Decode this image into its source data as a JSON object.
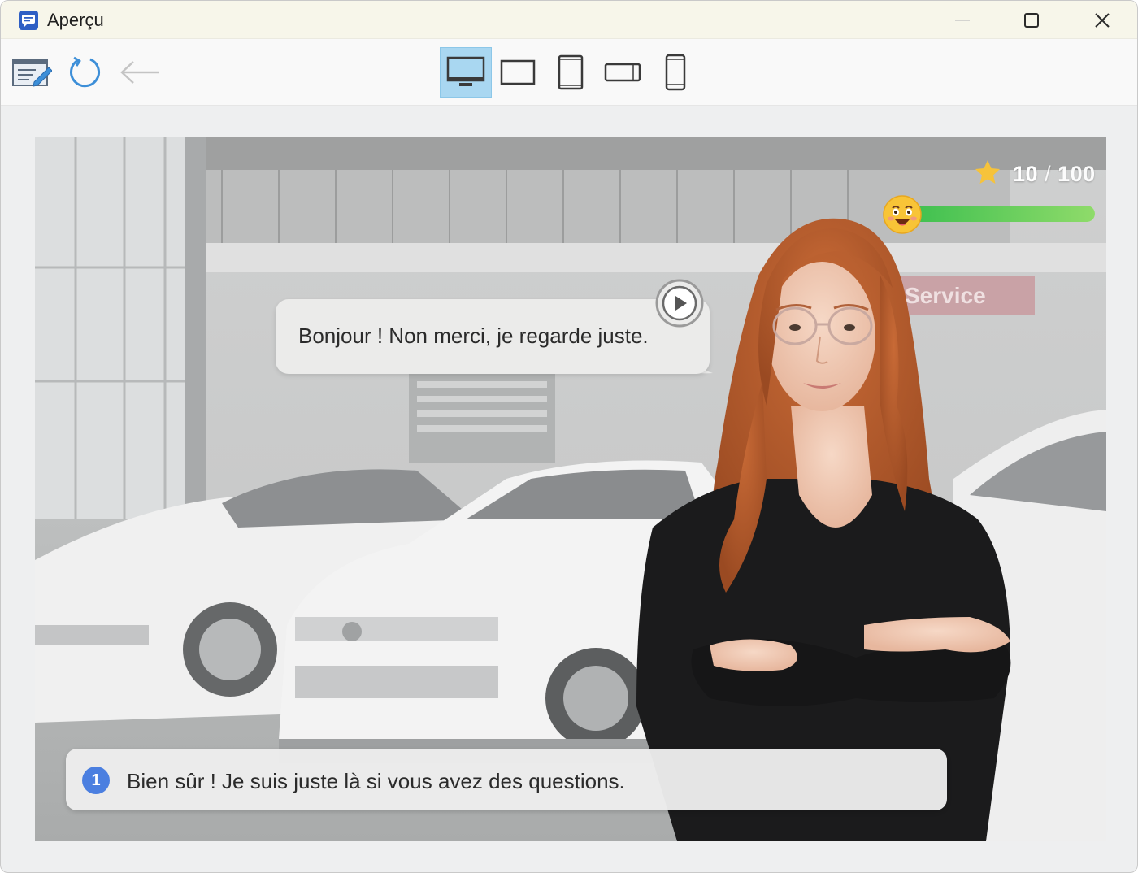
{
  "window": {
    "title": "Aperçu",
    "app_icon": "chat-preview-icon",
    "controls": [
      "minimize-icon",
      "maximize-icon",
      "close-icon"
    ]
  },
  "toolbar": {
    "left_buttons": [
      "edit-icon",
      "reload-icon",
      "back-arrow-icon"
    ],
    "devices": [
      {
        "icon": "desktop-icon",
        "selected": true
      },
      {
        "icon": "laptop-icon",
        "selected": false
      },
      {
        "icon": "tablet-portrait-icon",
        "selected": false
      },
      {
        "icon": "tablet-landscape-icon",
        "selected": false
      },
      {
        "icon": "phone-icon",
        "selected": false
      }
    ],
    "selected_color": "#a9d7f1"
  },
  "scene": {
    "background_sign": "Service",
    "character": "saleswoman-avatar"
  },
  "score": {
    "current": "10",
    "separator": "/",
    "total": "100",
    "progress_fraction": 1.0,
    "mood": "happy-face-icon",
    "progress_color": "#3cbf4f"
  },
  "dialogue": {
    "speech": "Bonjour ! Non merci, je regarde juste.",
    "play_icon": "play-icon"
  },
  "answers": [
    {
      "number": "1",
      "text": "Bien sûr ! Je suis juste là si vous avez des questions.",
      "badge_color": "#4b7fe0"
    }
  ]
}
